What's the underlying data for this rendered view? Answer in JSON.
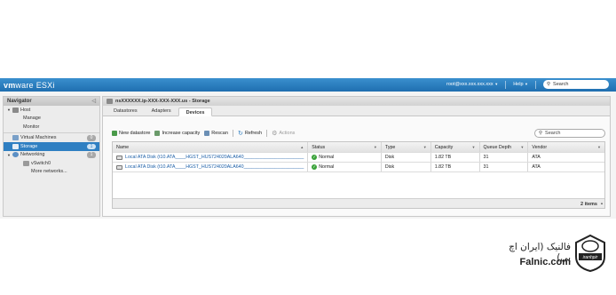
{
  "topbar": {
    "brand_vm": "vm",
    "brand_ware": "ware",
    "brand_product": "ESXi",
    "user": "root@xxx.xxx.xxx.xxx",
    "help": "Help",
    "search_placeholder": "Search"
  },
  "navigator": {
    "title": "Navigator",
    "items": [
      {
        "label": "Host",
        "badge": ""
      },
      {
        "label": "Manage",
        "badge": ""
      },
      {
        "label": "Monitor",
        "badge": ""
      },
      {
        "label": "Virtual Machines",
        "badge": "0"
      },
      {
        "label": "Storage",
        "badge": "1"
      },
      {
        "label": "Networking",
        "badge": "1"
      },
      {
        "label": "vSwitch0",
        "badge": ""
      },
      {
        "label": "More networks...",
        "badge": ""
      }
    ]
  },
  "main": {
    "title": "nsXXXXXX.ip-XXX-XXX-XXX.us - Storage",
    "tabs": [
      "Datastores",
      "Adapters",
      "Devices"
    ],
    "active_tab": "Devices"
  },
  "toolbar": {
    "new_datastore": "New datastore",
    "increase_capacity": "Increase capacity",
    "rescan": "Rescan",
    "refresh": "Refresh",
    "actions": "Actions",
    "search_placeholder": "Search"
  },
  "grid": {
    "columns": [
      "Name",
      "Status",
      "Type",
      "Capacity",
      "Queue Depth",
      "Vendor"
    ],
    "rows": [
      {
        "name": "Local ATA Disk (t10.ATA____HGST_HUS724020ALA640_______________________",
        "status": "Normal",
        "type": "Disk",
        "capacity": "1.82 TB",
        "queue_depth": "31",
        "vendor": "ATA"
      },
      {
        "name": "Local ATA Disk (t10.ATA____HGST_HUS724020ALA640_______________________",
        "status": "Normal",
        "type": "Disk",
        "capacity": "1.82 TB",
        "queue_depth": "31",
        "vendor": "ATA"
      }
    ],
    "footer_count": "2 items"
  },
  "watermark": {
    "fa_text": "فالنیک (ایران اچ پی)",
    "en_text": "Falnic.com",
    "logo_text": "iranhpir"
  },
  "colors": {
    "topbar": "#2677bb",
    "selected": "#2f7fc2",
    "link": "#1c5fa8",
    "ok": "#3aa23a"
  }
}
